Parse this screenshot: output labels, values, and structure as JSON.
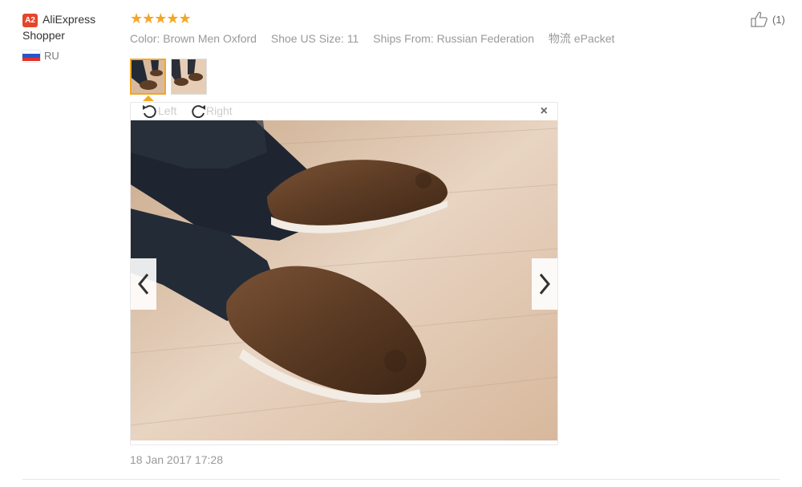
{
  "reviewer": {
    "badge": "A2",
    "name": "AliExpress Shopper",
    "country_code": "RU"
  },
  "rating": {
    "stars": 5,
    "max": 5,
    "star_color": "#f5a623"
  },
  "attributes": [
    {
      "key": "Color:",
      "value": "Brown Men Oxford"
    },
    {
      "key": "Shoe US Size:",
      "value": "11"
    },
    {
      "key": "Ships From:",
      "value": "Russian Federation"
    },
    {
      "key": "物流",
      "value": "ePacket"
    }
  ],
  "likes": {
    "count_label": "(1)"
  },
  "photos": {
    "count": 2,
    "selected_index": 0
  },
  "viewer": {
    "rotate_left_label": "Left",
    "rotate_right_label": "Right",
    "close_glyph": "×"
  },
  "date": "18 Jan 2017 17:28",
  "colors": {
    "accent": "#f5a623",
    "badge": "#e4462c"
  }
}
